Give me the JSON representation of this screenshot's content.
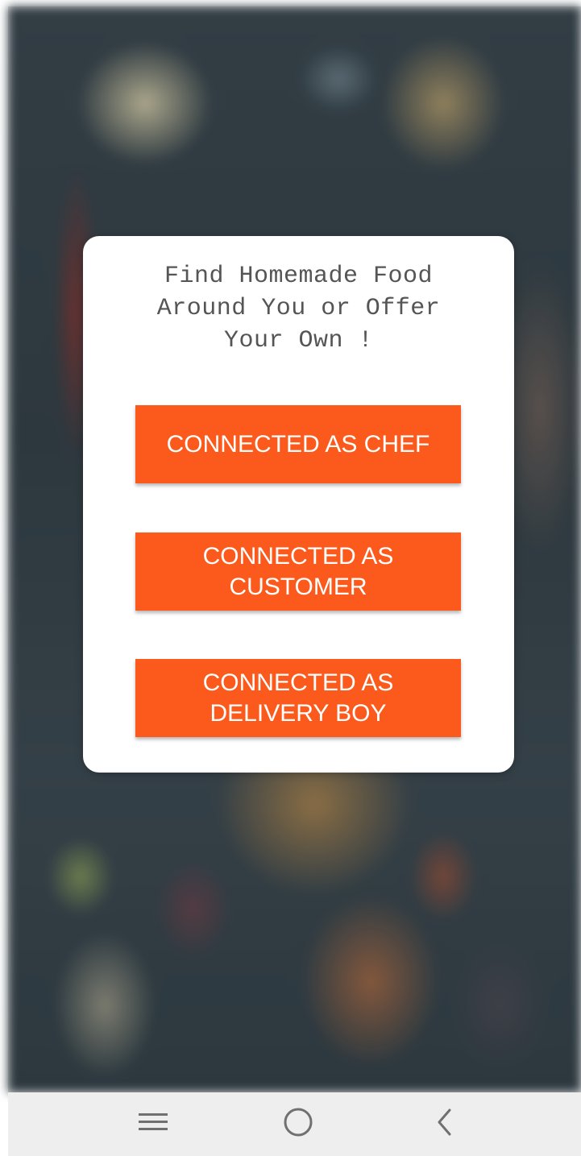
{
  "dialog": {
    "headline_lines": [
      "Find Homemade Food",
      "Around You or Offer",
      "Your Own !"
    ]
  },
  "buttons": {
    "chef": "CONNECTED AS CHEF",
    "customer": "CONNECTED AS CUSTOMER",
    "delivery": "CONNECTED AS DELIVERY BOY"
  },
  "navbar": {
    "icons": [
      "recent-apps-icon",
      "home-icon",
      "back-icon"
    ]
  },
  "colors": {
    "accent": "#fc5a1c",
    "card_bg": "#ffffff",
    "headline_text": "#555555",
    "navbar_bg": "#eeeeee"
  }
}
